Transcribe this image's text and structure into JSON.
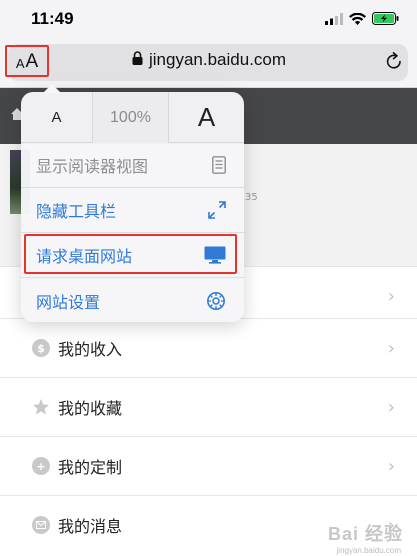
{
  "status_bar": {
    "time": "11:49",
    "icons": [
      "cellular-signal-icon",
      "wifi-icon",
      "battery-charging-icon"
    ]
  },
  "address_bar": {
    "text_size_button": {
      "small": "A",
      "big": "A"
    },
    "url": "jingyan.baidu.com",
    "icons": [
      "lock-icon",
      "reload-icon"
    ]
  },
  "popover": {
    "font_size": {
      "decrease": "A",
      "zoom": "100%",
      "increase": "A"
    },
    "items": [
      {
        "label": "显示阅读器视图",
        "icon": "reader-view-icon",
        "enabled": false
      },
      {
        "label": "隐藏工具栏",
        "icon": "expand-arrows-icon",
        "enabled": true
      },
      {
        "label": "请求桌面网站",
        "icon": "desktop-monitor-icon",
        "enabled": true,
        "highlighted": true
      },
      {
        "label": "网站设置",
        "icon": "settings-gear-icon",
        "enabled": true
      }
    ]
  },
  "background_page": {
    "partial_number": "35",
    "list_items": [
      {
        "label": "我的收入",
        "icon": "dollar-icon"
      },
      {
        "label": "我的收藏",
        "icon": "star-icon"
      },
      {
        "label": "我的定制",
        "icon": "plus-icon"
      },
      {
        "label": "我的消息",
        "icon": "mail-icon"
      }
    ]
  },
  "colors": {
    "highlight_red": "#e8322e",
    "link_blue": "#2f7ad6",
    "disabled_gray": "#8e8e93",
    "page_header": "#454649"
  },
  "watermark": {
    "text": "Bai 经验",
    "sub": "jingyan.baidu.com"
  }
}
